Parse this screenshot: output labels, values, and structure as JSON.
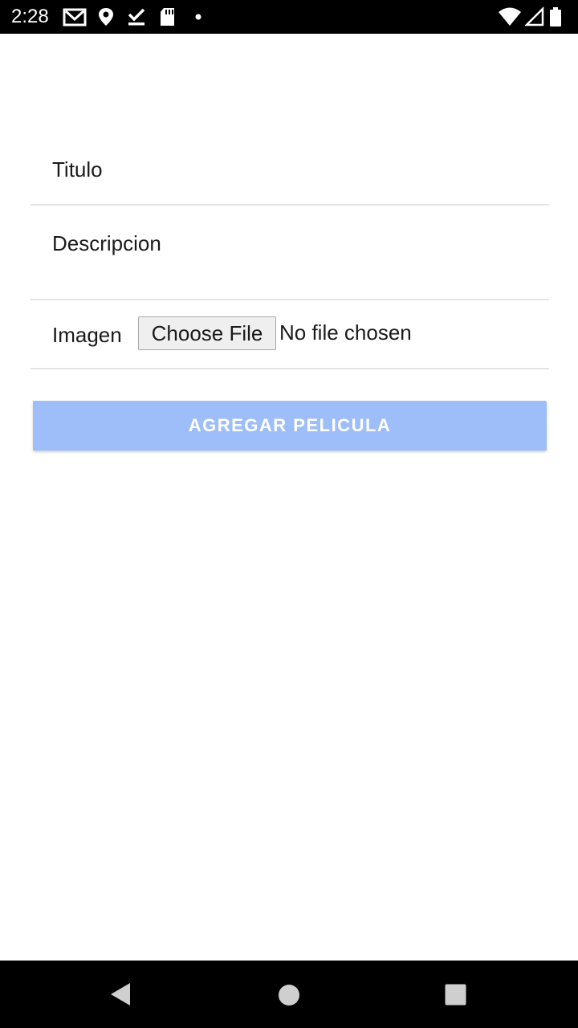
{
  "status_bar": {
    "time": "2:28",
    "icons": [
      "gmail-icon",
      "location-icon",
      "download-done-icon",
      "sd-card-icon",
      "notification-dot-icon",
      "wifi-icon",
      "cell-signal-icon",
      "battery-icon"
    ]
  },
  "form": {
    "titulo_label": "Titulo",
    "descripcion_label": "Descripcion",
    "imagen_label": "Imagen",
    "choose_file_label": "Choose File",
    "file_status": "No file chosen",
    "submit_label": "AGREGAR PELICULA"
  },
  "colors": {
    "submit_button": "#9dbef9",
    "divider": "#e3e3e3",
    "system_bars": "#000000"
  },
  "nav_bar": {
    "icons": [
      "back-icon",
      "home-icon",
      "recents-icon"
    ]
  }
}
